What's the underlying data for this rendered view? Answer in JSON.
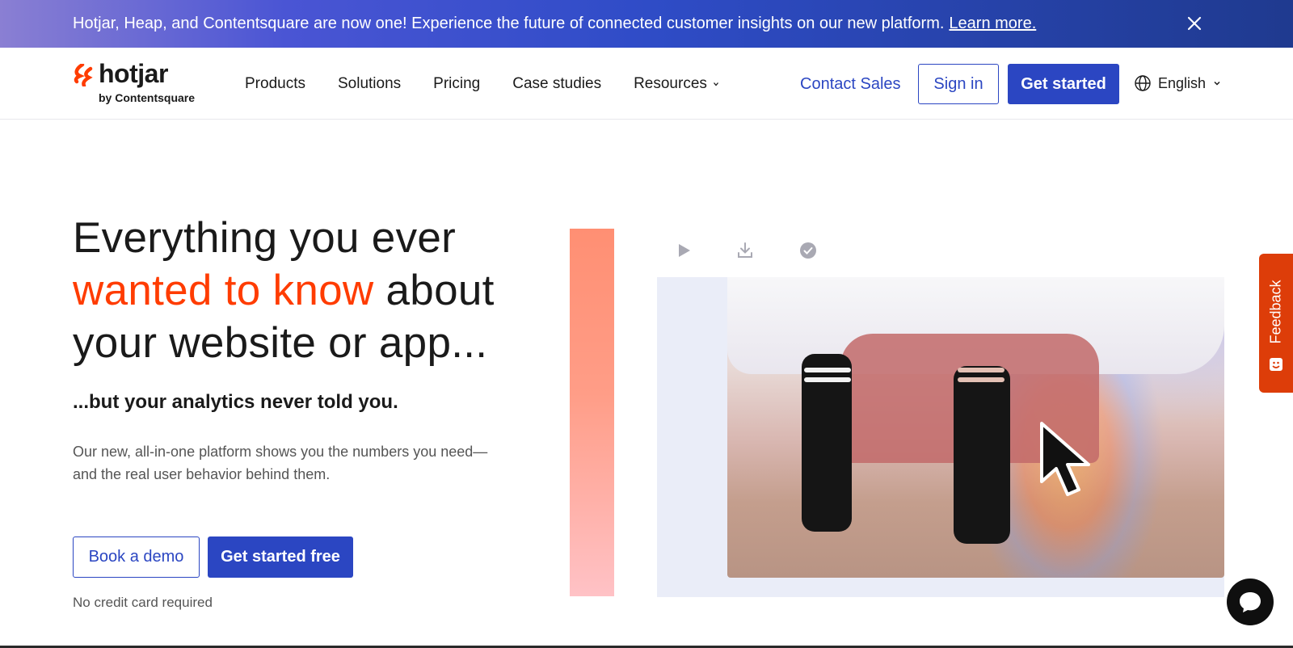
{
  "banner": {
    "message": "Hotjar, Heap, and Contentsquare are now one! Experience the future of connected customer insights on our new platform.",
    "link_label": "Learn more."
  },
  "logo": {
    "word": "hotjar",
    "sub": "by Contentsquare"
  },
  "nav": {
    "items": [
      {
        "label": "Products"
      },
      {
        "label": "Solutions"
      },
      {
        "label": "Pricing"
      },
      {
        "label": "Case studies"
      },
      {
        "label": "Resources"
      }
    ],
    "contact_label": "Contact Sales",
    "signin_label": "Sign in",
    "get_started_label": "Get started",
    "language_label": "English"
  },
  "hero": {
    "title_part1": "Everything you ever",
    "title_accent": "wanted to know",
    "title_part2": "about your website or app...",
    "subtitle": "...but your analytics never told you.",
    "description": "Our new, all-in-one platform shows you the numbers you need—and the real user behavior behind them.",
    "demo_label": "Book a demo",
    "free_label": "Get started free",
    "note": "No credit card required"
  },
  "feedback": {
    "label": "Feedback"
  },
  "colors": {
    "brand_blue": "#2b46c2",
    "accent_orange": "#ff3c00",
    "feedback_red": "#dd3d09"
  },
  "icons": {
    "logo_mark": "hotjar-logo-icon",
    "banner_close": "close-icon",
    "language": "globe-icon",
    "toolbar": [
      "play-icon",
      "download-icon",
      "check-circle-icon"
    ],
    "cursor": "cursor-arrow-icon",
    "chat": "chat-bubble-icon"
  }
}
